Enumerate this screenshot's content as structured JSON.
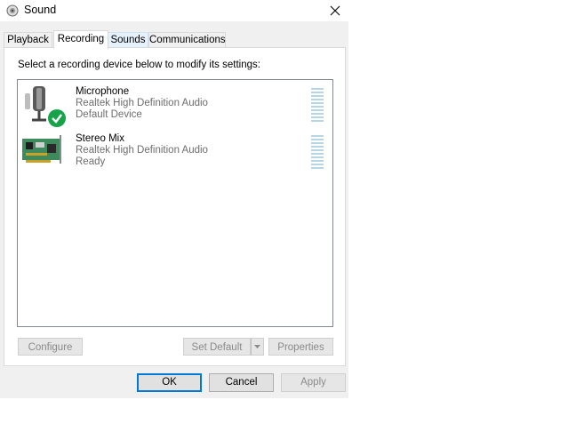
{
  "window": {
    "title": "Sound",
    "icon": "speaker-icon"
  },
  "tabs": [
    {
      "label": "Playback"
    },
    {
      "label": "Recording"
    },
    {
      "label": "Sounds"
    },
    {
      "label": "Communications"
    }
  ],
  "recording": {
    "instruction": "Select a recording device below to modify its settings:",
    "devices": [
      {
        "name": "Microphone",
        "driver": "Realtek High Definition Audio",
        "status": "Default Device",
        "icon": "microphone-icon",
        "default": true
      },
      {
        "name": "Stereo Mix",
        "driver": "Realtek High Definition Audio",
        "status": "Ready",
        "icon": "sound-card-icon",
        "default": false
      }
    ],
    "buttons": {
      "configure": "Configure",
      "set_default": "Set Default",
      "properties": "Properties"
    }
  },
  "footer": {
    "ok": "OK",
    "cancel": "Cancel",
    "apply": "Apply"
  },
  "colors": {
    "accent": "#0078d7",
    "check": "#16a34a",
    "meter": "#b9d5e3"
  }
}
